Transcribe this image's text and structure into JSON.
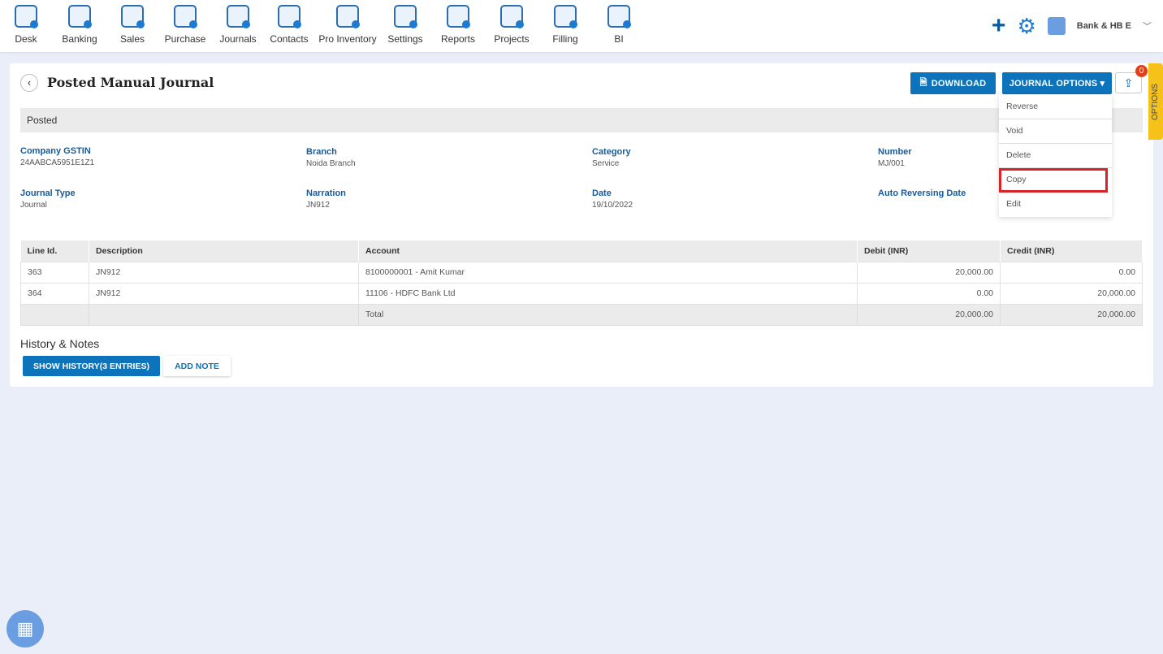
{
  "nav": [
    "Desk",
    "Banking",
    "Sales",
    "Purchase",
    "Journals",
    "Contacts",
    "Pro Inventory",
    "Settings",
    "Reports",
    "Projects",
    "Filling",
    "BI"
  ],
  "header": {
    "company": "Bank & HB E"
  },
  "page": {
    "title": "Posted Manual Journal",
    "download": "DOWNLOAD",
    "journal_options": "JOURNAL OPTIONS ▾",
    "badge": "0",
    "status": "Posted"
  },
  "menu": [
    "Reverse",
    "Void",
    "Delete",
    "Copy",
    "Edit"
  ],
  "fields": [
    {
      "label": "Company GSTIN",
      "value": "24AABCA5951E1Z1"
    },
    {
      "label": "Branch",
      "value": "Noida Branch"
    },
    {
      "label": "Category",
      "value": "Service"
    },
    {
      "label": "Number",
      "value": "MJ/001"
    },
    {
      "label": "Journal Type",
      "value": "Journal"
    },
    {
      "label": "Narration",
      "value": "JN912"
    },
    {
      "label": "Date",
      "value": "19/10/2022"
    },
    {
      "label": "Auto Reversing Date",
      "value": ""
    }
  ],
  "table": {
    "headers": [
      "Line Id.",
      "Description",
      "Account",
      "Debit (INR)",
      "Credit (INR)"
    ],
    "rows": [
      [
        "363",
        "JN912",
        "8100000001 - Amit Kumar",
        "20,000.00",
        "0.00"
      ],
      [
        "364",
        "JN912",
        "11106 - HDFC Bank Ltd",
        "0.00",
        "20,000.00"
      ]
    ],
    "total": {
      "label": "Total",
      "debit": "20,000.00",
      "credit": "20,000.00"
    }
  },
  "history": {
    "title": "History & Notes",
    "show": "SHOW HISTORY(3 ENTRIES)",
    "add": "ADD NOTE"
  },
  "side_tab": "OPTIONS"
}
